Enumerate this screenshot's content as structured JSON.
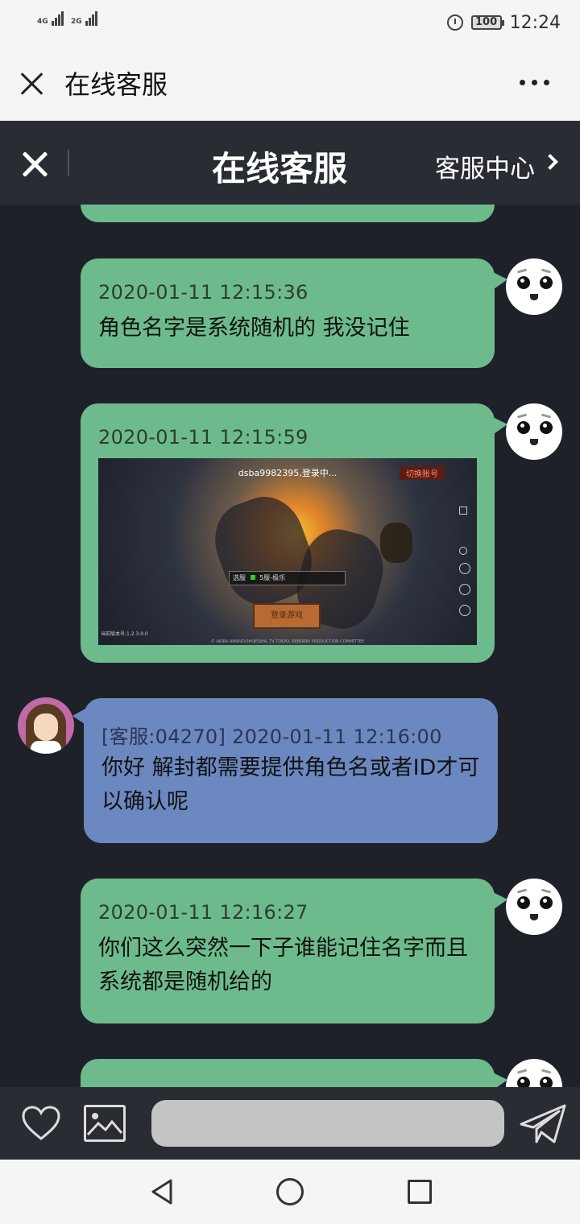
{
  "status_bar": {
    "net1": "4G",
    "net2": "2G",
    "battery": "100",
    "time": "12:24"
  },
  "app_bar": {
    "close_icon": "close-icon",
    "title": "在线客服",
    "more_icon": "more-icon"
  },
  "chat_header": {
    "title": "在线客服",
    "service_center": "客服中心"
  },
  "messages": [
    {
      "from": "user",
      "meta": "2020-01-11 12:15:36",
      "text": "角色名字是系统随机的 我没记住"
    },
    {
      "from": "user",
      "meta": "2020-01-11 12:15:59",
      "type": "image",
      "image": {
        "login_text": "dsba9982395,登录中...",
        "switch_account": "切换账号",
        "server_label": "选服",
        "server_name": "5服-极乐",
        "enter_game": "登录游戏",
        "version": "当前版本号:1.2.3.0.0",
        "copyright": "© AKIRA AMANO/SHUEISHA, TV TOKYO, REBORN! PRODUCTION COMMITTEE"
      }
    },
    {
      "from": "agent",
      "meta": "[客服:04270] 2020-01-11 12:16:00",
      "text": "你好 解封都需要提供角色名或者ID才可以确认呢"
    },
    {
      "from": "user",
      "meta": "2020-01-11 12:16:27",
      "text": "你们这么突然一下子谁能记住名字而且系统都是随机给的"
    }
  ],
  "input_bar": {
    "favorite_icon": "heart-icon",
    "image_icon": "image-icon",
    "input_value": "",
    "send_icon": "send-icon"
  },
  "colors": {
    "user_bubble": "#6dbb8c",
    "agent_bubble": "#6c88c0",
    "chat_bg": "#1f2129",
    "header_bg": "#2a2c34"
  }
}
